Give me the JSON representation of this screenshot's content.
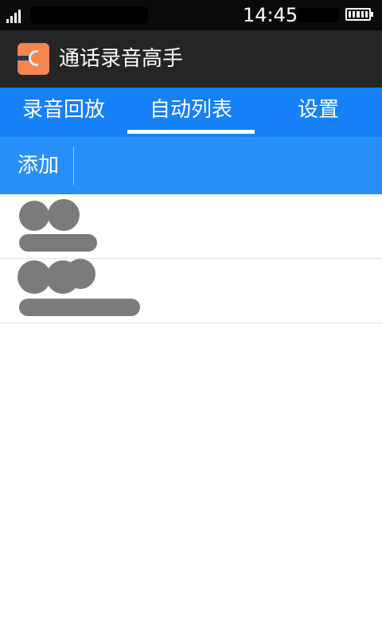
{
  "status_bar": {
    "time": "14:45"
  },
  "title_bar": {
    "app_title": "通话录音高手",
    "app_icon": "recorder-app-icon"
  },
  "tabs": [
    {
      "label": "录音回放",
      "active": false
    },
    {
      "label": "自动列表",
      "active": true
    },
    {
      "label": "设置",
      "active": false
    }
  ],
  "action_bar": {
    "add_label": "添加"
  },
  "list": [
    {
      "name": "",
      "number": ""
    },
    {
      "name": "",
      "number": ""
    }
  ],
  "colors": {
    "status_bar": "#0b0b0b",
    "title_bar": "#252525",
    "tabs": "#1680f6",
    "action_bar": "#2690f8",
    "app_icon": "#f5844f"
  }
}
